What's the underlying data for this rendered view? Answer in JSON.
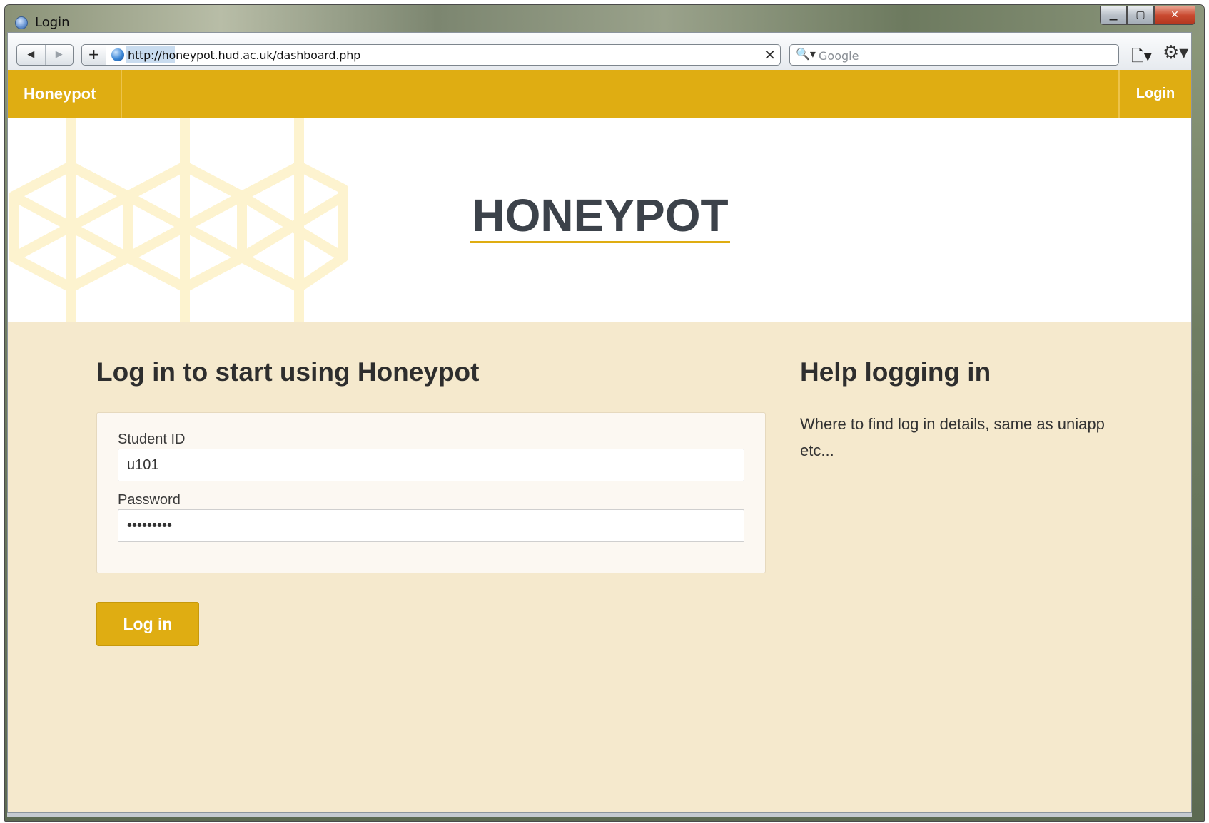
{
  "window": {
    "title": "Login",
    "controls": {
      "minimize": "▁",
      "maximize": "▢",
      "close": "✕"
    }
  },
  "browser": {
    "back_icon": "◀",
    "forward_icon": "▶",
    "add_icon": "+",
    "url": "http://honeypot.hud.ac.uk/dashboard.php",
    "clear_icon": "✕",
    "search_icon": "🔍▾",
    "search_placeholder": "Google",
    "page_menu_icon": "🗋▾",
    "settings_icon": "⚙▾"
  },
  "navbar": {
    "brand": "Honeypot",
    "login_link": "Login",
    "color": "#dfad12"
  },
  "hero": {
    "title": "HONEYPOT"
  },
  "login": {
    "heading": "Log in to start using Honeypot",
    "student_id_label": "Student ID",
    "student_id_value": "u101",
    "password_label": "Password",
    "password_value": "secret123",
    "submit_label": "Log in"
  },
  "help": {
    "heading": "Help logging in",
    "text": "Where to find log in details, same as uniapp etc..."
  },
  "colors": {
    "accent": "#dfad12",
    "page_background": "#f5e9cd",
    "panel_background": "#fcf8f2",
    "heading_text": "#2e2e2e"
  }
}
